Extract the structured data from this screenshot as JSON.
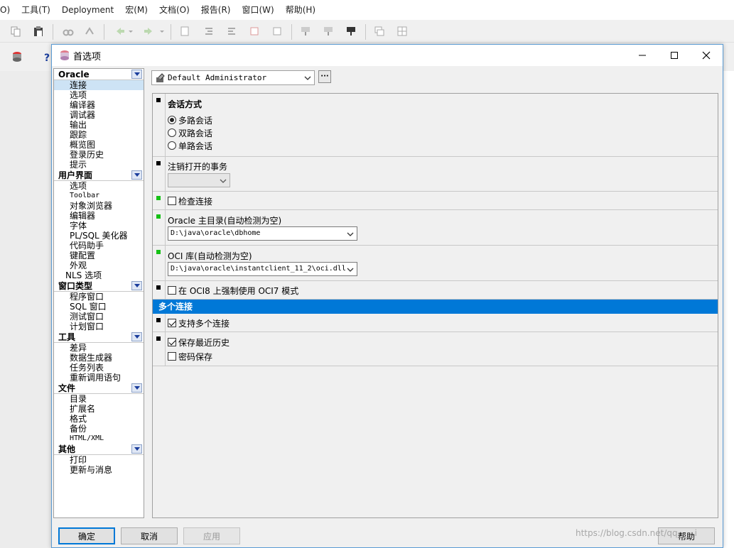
{
  "menubar": {
    "items": [
      "O)",
      "工具(T)",
      "Deployment",
      "宏(M)",
      "文档(O)",
      "报告(R)",
      "窗口(W)",
      "帮助(H)"
    ]
  },
  "dialog": {
    "title": "首选项",
    "title_icon": "database-icon",
    "buttons": {
      "ok": "确定",
      "cancel": "取消",
      "apply": "应用",
      "help": "帮助"
    }
  },
  "nav": {
    "categories": [
      {
        "label": "Oracle",
        "items": [
          "连接",
          "选项",
          "编译器",
          "调试器",
          "输出",
          "跟踪",
          "概览图",
          "登录历史",
          "提示"
        ]
      },
      {
        "label": "用户界面",
        "items": [
          "选项",
          "Toolbar",
          "对象浏览器",
          "编辑器",
          "字体",
          "PL/SQL 美化器",
          "代码助手",
          "键配置",
          "外观",
          "NLS 选项"
        ]
      },
      {
        "label": "窗口类型",
        "items": [
          "程序窗口",
          "SQL 窗口",
          "测试窗口",
          "计划窗口"
        ]
      },
      {
        "label": "工具",
        "items": [
          "差异",
          "数据生成器",
          "任务列表",
          "重新调用语句"
        ]
      },
      {
        "label": "文件",
        "items": [
          "目录",
          "扩展名",
          "格式",
          "备份",
          "HTML/XML"
        ]
      },
      {
        "label": "其他",
        "items": [
          "打印",
          "更新与消息"
        ]
      }
    ],
    "selected": "连接"
  },
  "profile": {
    "value": "Default Administrator",
    "more": "···"
  },
  "sections": {
    "session_mode": {
      "title": "会话方式",
      "options": [
        "多路会话",
        "双路会话",
        "单路会话"
      ],
      "selected": "多路会话"
    },
    "logoff_tx": {
      "label": "注销打开的事务",
      "value": ""
    },
    "check_connection": {
      "label": "检查连接",
      "checked": false
    },
    "oracle_home": {
      "label": "Oracle 主目录(自动检测为空)",
      "value": "D:\\java\\oracle\\dbhome"
    },
    "oci_lib": {
      "label": "OCI 库(自动检测为空)",
      "value": "D:\\java\\oracle\\instantclient_11_2\\oci.dll"
    },
    "oci7": {
      "label": "在 OCI8 上强制使用 OCI7 模式",
      "checked": false
    },
    "multi_header": "多个连接",
    "multi_support": {
      "label": "支持多个连接",
      "checked": true
    },
    "history": {
      "label": "保存最近历史",
      "checked": true
    },
    "password": {
      "label": "密码保存",
      "checked": false
    }
  },
  "watermark": "https://blog.csdn.net/qq____i"
}
